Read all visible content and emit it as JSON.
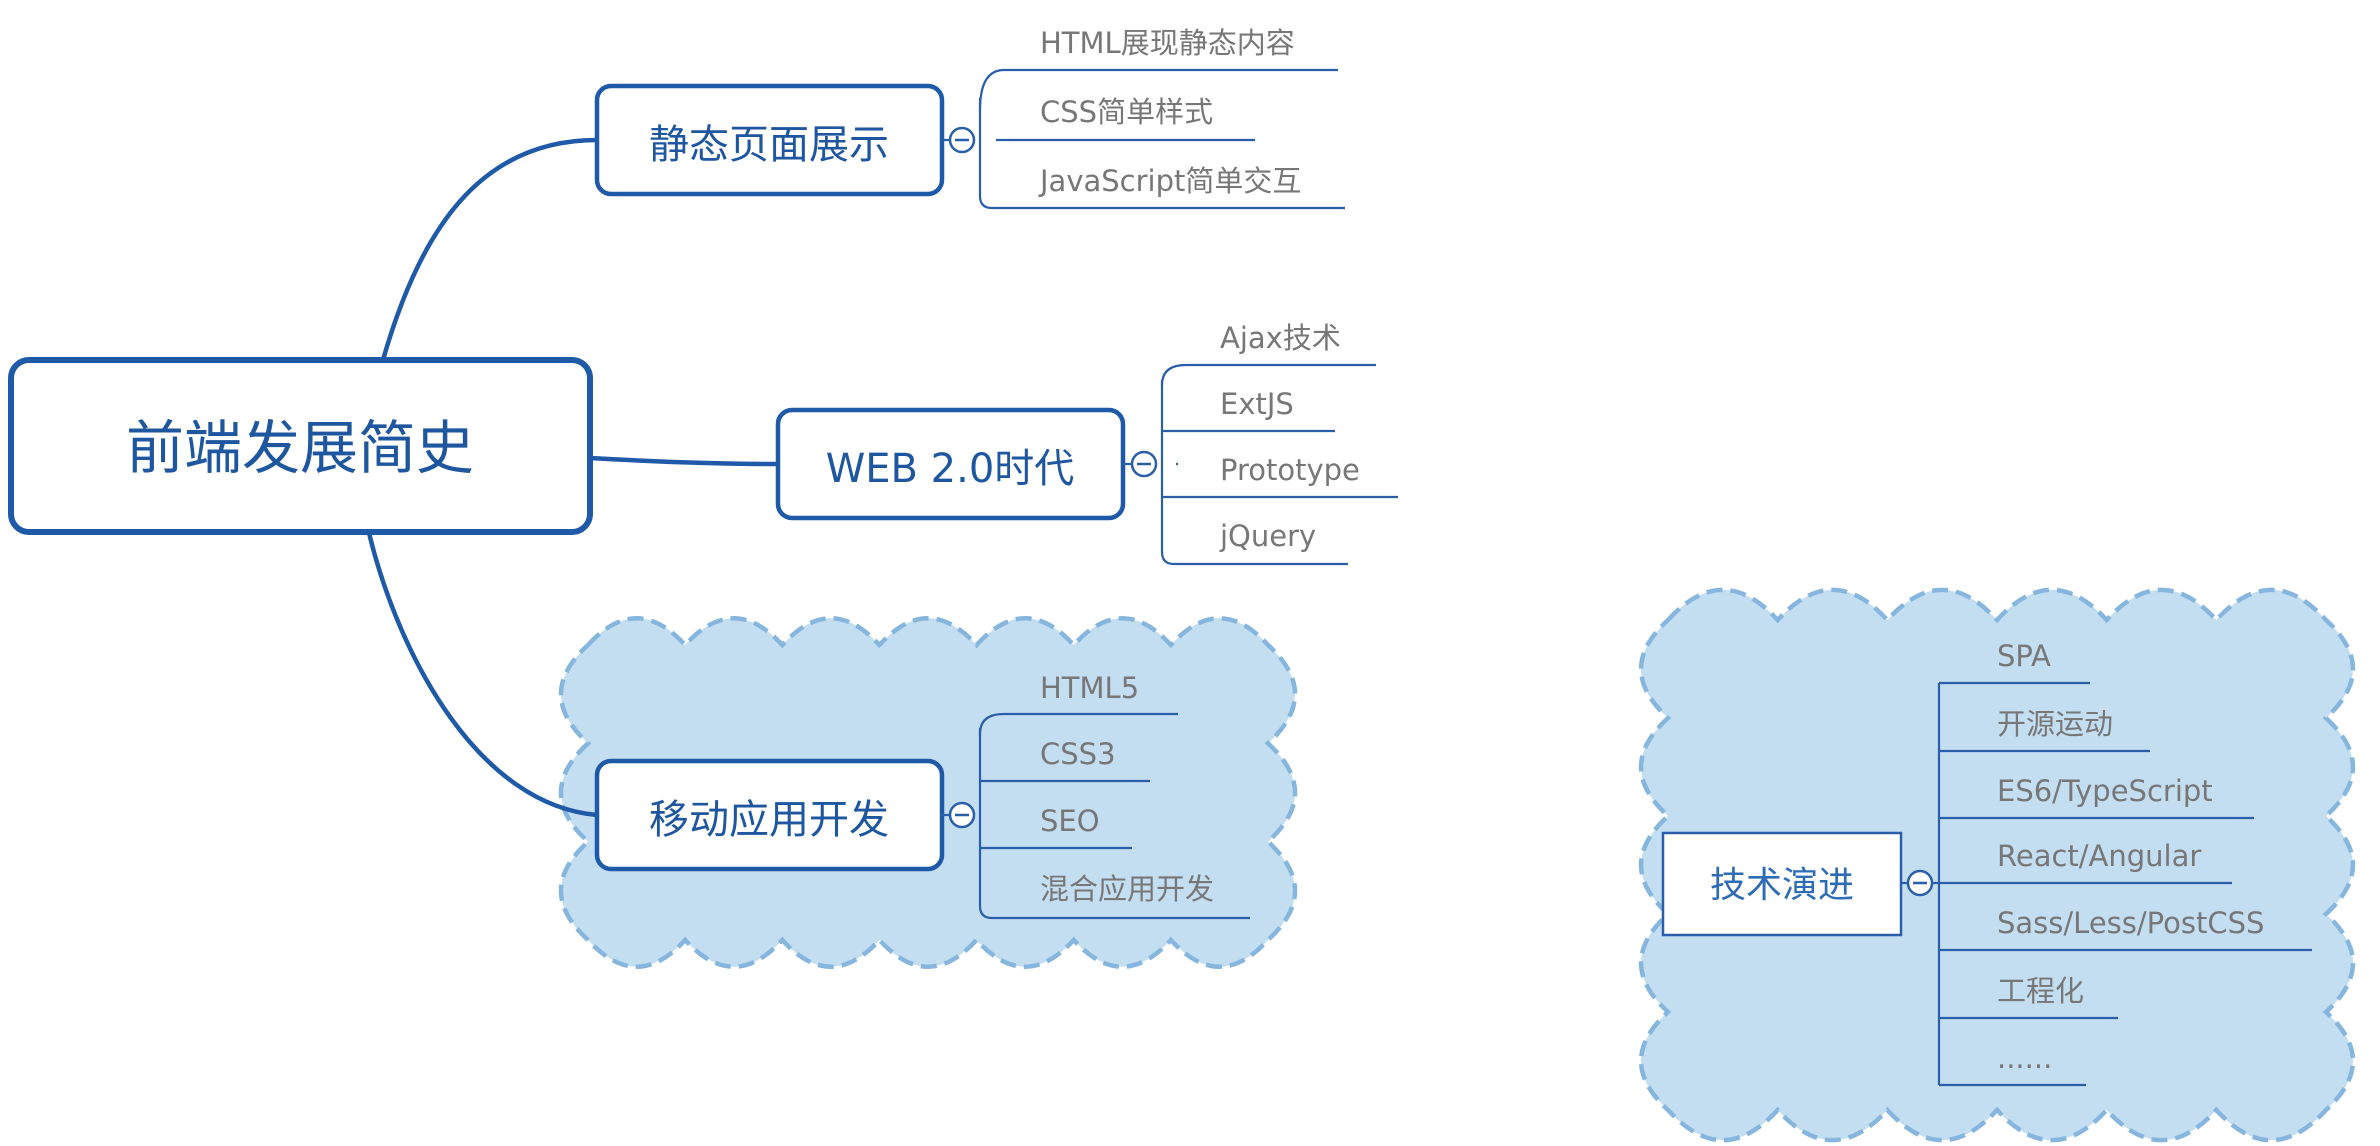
{
  "mindmap": {
    "root": {
      "label": "前端发展简史"
    },
    "branches": [
      {
        "id": "static",
        "label": "静态页面展示",
        "children": [
          "HTML展现静态内容",
          "CSS简单样式",
          "JavaScript简单交互"
        ]
      },
      {
        "id": "web2",
        "label": "WEB 2.0时代",
        "children": [
          "Ajax技术",
          "ExtJS",
          "Prototype",
          "jQuery"
        ]
      },
      {
        "id": "mobile",
        "label": "移动应用开发",
        "children": [
          "HTML5",
          "CSS3",
          "SEO",
          "混合应用开发"
        ]
      }
    ],
    "floating": {
      "label": "技术演进",
      "children": [
        "SPA",
        "开源运动",
        "ES6/TypeScript",
        "React/Angular",
        "Sass/Less/PostCSS",
        "工程化",
        "......"
      ]
    },
    "colors": {
      "node_border": "#1e5aa8",
      "node_text": "#1e56a0",
      "cloud_fill": "#c3ddf1",
      "cloud_stroke": "#86b6dd",
      "leaf_text": "#777777"
    }
  }
}
